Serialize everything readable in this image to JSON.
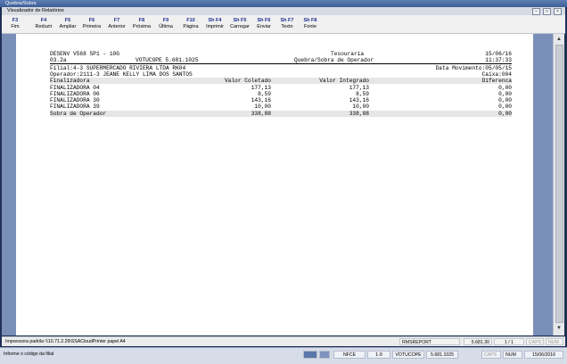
{
  "window": {
    "outer_title": "Quebra/Sobra",
    "inner_title": "Visualizador de Relatórios"
  },
  "toolbar": [
    {
      "key": "F3",
      "label": "Fim"
    },
    {
      "key": "F4",
      "label": "Reduzir"
    },
    {
      "key": "F5",
      "label": "Ampliar"
    },
    {
      "key": "F6",
      "label": "Primeira"
    },
    {
      "key": "F7",
      "label": "Anterior"
    },
    {
      "key": "F8",
      "label": "Próxima"
    },
    {
      "key": "F9",
      "label": "Última"
    },
    {
      "key": "F10",
      "label": "Página"
    },
    {
      "key": "Sh F4",
      "label": "Imprimir"
    },
    {
      "key": "Sh F5",
      "label": "Carregar"
    },
    {
      "key": "Sh F6",
      "label": "Enviar"
    },
    {
      "key": "Sh F7",
      "label": "Texto"
    },
    {
      "key": "Sh F8",
      "label": "Fonte"
    }
  ],
  "report": {
    "system": "DESENV V568 SP1 - 10G",
    "version": "03.2a",
    "company": "VOTUCOPE 5.681.1025",
    "department": "Tesouraria",
    "title": "Quebra/Sobra de Operador",
    "date": "15/06/16",
    "time": "11:37:33",
    "filial": "Filial:4-3 SUPERMERCADO RIVIERA LTDA RK04",
    "movimento": "Data Movimento:05/05/15",
    "operador": "Operador:2111-3 JEANE KELLY LIMA DOS SANTOS",
    "caixa": "Caixa:004",
    "columns": [
      "Finalizadora",
      "Valor Coletado",
      "Valor Integrado",
      "Diferenca"
    ],
    "rows": [
      [
        "FINALIZADORA 04",
        "177,13",
        "177,13",
        "0,00"
      ],
      [
        "FINALIZADORA 06",
        "8,59",
        "8,59",
        "0,00"
      ],
      [
        "FINALIZADORA 30",
        "143,16",
        "143,16",
        "0,00"
      ],
      [
        "FINALIZADORA 39",
        "10,00",
        "10,00",
        "0,00"
      ]
    ],
    "total": [
      "Sobra de Operador",
      "338,88",
      "338,88",
      "0,00"
    ]
  },
  "status": {
    "printer": "Impressora padrão \\\\10.71.2.29\\SSACloudPrinter papel A4",
    "report_name": "RMSREPORT",
    "version": "5.681.30",
    "page": "1 / 1",
    "caps": "CAPS",
    "num": "NUM"
  },
  "taskbar": {
    "hint": "Informe o código da filial",
    "nfce": "NFCE",
    "pos": "1-9",
    "company": "VOTUCOPE",
    "version": "5.681.1025",
    "caps": "CAPS",
    "num": "NUM",
    "date": "15/06/2016"
  }
}
